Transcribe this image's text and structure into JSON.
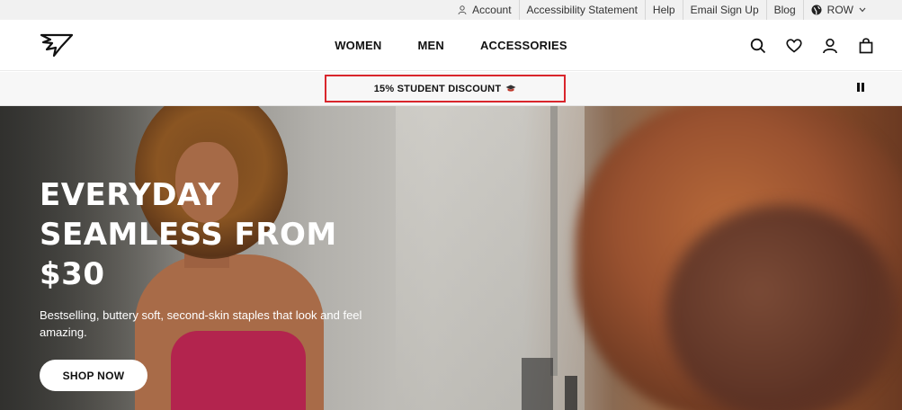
{
  "utility_bar": {
    "items": [
      {
        "label": "Account",
        "icon": "user-icon"
      },
      {
        "label": "Accessibility Statement"
      },
      {
        "label": "Help"
      },
      {
        "label": "Email Sign Up"
      },
      {
        "label": "Blog"
      }
    ],
    "region": {
      "label": "ROW",
      "icon": "globe-icon"
    }
  },
  "header": {
    "logo": "gymshark-logo-icon",
    "nav": [
      "WOMEN",
      "MEN",
      "ACCESSORIES"
    ],
    "icons": [
      "search-icon",
      "heart-icon",
      "user-icon",
      "bag-icon"
    ]
  },
  "promo": {
    "text": "15% STUDENT DISCOUNT",
    "icon": "graduation-cap-icon",
    "highlight_color": "#d9262c"
  },
  "hero": {
    "title_lines": [
      "EVERYDAY",
      "SEAMLESS FROM",
      "$30"
    ],
    "subtitle": "Bestselling, buttery soft, second-skin staples that look and feel amazing.",
    "cta": "SHOP NOW"
  }
}
